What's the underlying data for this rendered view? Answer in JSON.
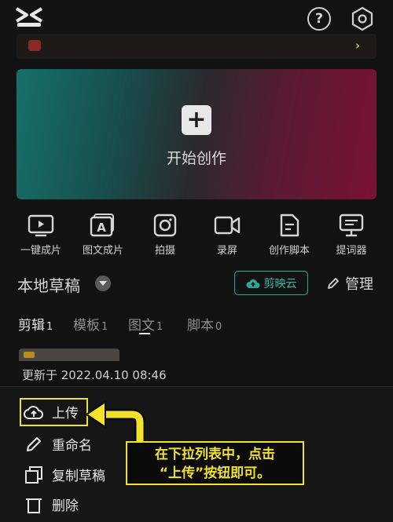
{
  "colors": {
    "accent_teal": "#2fa59a",
    "highlight_yellow": "#f2e22b",
    "background": "#121212"
  },
  "header": {
    "help_label": "?"
  },
  "create": {
    "label": "开始创作"
  },
  "tools": [
    {
      "label": "一键成片",
      "icon": "play-screen-icon"
    },
    {
      "label": "图文成片",
      "icon": "text-to-video-icon"
    },
    {
      "label": "拍摄",
      "icon": "camera-icon"
    },
    {
      "label": "录屏",
      "icon": "screen-record-icon"
    },
    {
      "label": "创作脚本",
      "icon": "script-icon"
    },
    {
      "label": "提词器",
      "icon": "teleprompter-icon"
    }
  ],
  "drafts": {
    "title": "本地草稿",
    "cloud_button": "剪映云",
    "manage_label": "管理",
    "tabs": [
      {
        "label": "剪辑",
        "count": "1"
      },
      {
        "label": "模板",
        "count": "1"
      },
      {
        "label": "图文",
        "count": "1"
      },
      {
        "label": "脚本",
        "count": "0"
      }
    ],
    "item_updated": "更新于 2022.04.10 08:46"
  },
  "menu": [
    {
      "label": "上传",
      "icon": "cloud-upload-icon"
    },
    {
      "label": "重命名",
      "icon": "pencil-icon"
    },
    {
      "label": "复制草稿",
      "icon": "copy-icon"
    },
    {
      "label": "删除",
      "icon": "trash-icon"
    }
  ],
  "callout": {
    "line1": "在下拉列表中，点击",
    "line2": "“上传”按钮即可。"
  }
}
